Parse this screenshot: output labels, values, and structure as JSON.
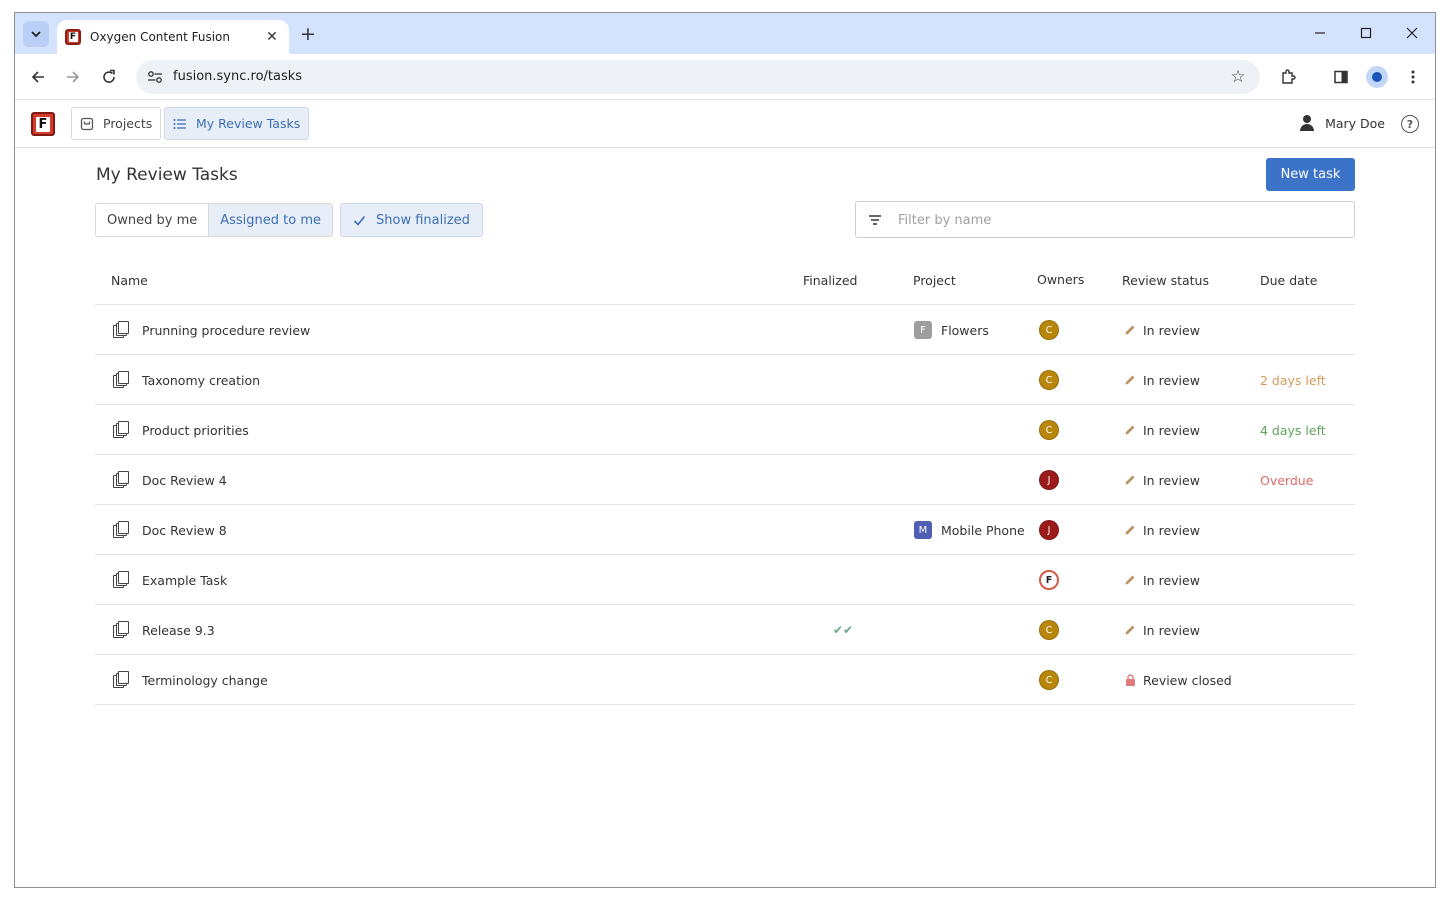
{
  "browser": {
    "tab_title": "Oxygen Content Fusion",
    "url": "fusion.sync.ro/tasks"
  },
  "header": {
    "logo_letter": "F",
    "projects_label": "Projects",
    "my_tasks_label": "My Review Tasks",
    "user_name": "Mary Doe",
    "help_glyph": "?"
  },
  "page": {
    "title": "My Review Tasks",
    "new_task_label": "New task",
    "owned_label": "Owned by me",
    "assigned_label": "Assigned to me",
    "show_finalized_label": "Show finalized",
    "filter_placeholder": "Filter by name"
  },
  "table": {
    "headers": {
      "name": "Name",
      "finalized": "Finalized",
      "project": "Project",
      "owners": "Owners",
      "review_status": "Review status",
      "due_date": "Due date"
    },
    "rows": [
      {
        "name": "Prunning procedure review",
        "finalized": "",
        "project_letter": "F",
        "project": "Flowers",
        "project_color": "#9e9e9e",
        "owner": "C",
        "owner_color": "#b8860b",
        "status": "In review",
        "status_icon": "pencil-icon",
        "due": "",
        "due_color": "#333333"
      },
      {
        "name": "Taxonomy creation",
        "finalized": "",
        "project_letter": "",
        "project": "",
        "project_color": "",
        "owner": "C",
        "owner_color": "#b8860b",
        "status": "In review",
        "status_icon": "pencil-icon",
        "due": "2 days left",
        "due_color": "#d39c5a"
      },
      {
        "name": "Product priorities",
        "finalized": "",
        "project_letter": "",
        "project": "",
        "project_color": "",
        "owner": "C",
        "owner_color": "#b8860b",
        "status": "In review",
        "status_icon": "pencil-icon",
        "due": "4 days left",
        "due_color": "#5fa35f"
      },
      {
        "name": "Doc Review 4",
        "finalized": "",
        "project_letter": "",
        "project": "",
        "project_color": "",
        "owner": "J",
        "owner_color": "#9b1b1b",
        "status": "In review",
        "status_icon": "pencil-icon",
        "due": "Overdue",
        "due_color": "#e06a6a"
      },
      {
        "name": "Doc Review 8",
        "finalized": "",
        "project_letter": "M",
        "project": "Mobile Phone",
        "project_color": "#4f5fb4",
        "owner": "J",
        "owner_color": "#9b1b1b",
        "status": "In review",
        "status_icon": "pencil-icon",
        "due": "",
        "due_color": "#333333"
      },
      {
        "name": "Example Task",
        "finalized": "",
        "project_letter": "",
        "project": "",
        "project_color": "",
        "owner": "F",
        "owner_color": "#ffffff",
        "status": "In review",
        "status_icon": "pencil-icon",
        "due": "",
        "due_color": "#333333"
      },
      {
        "name": "Release 9.3",
        "finalized": "✔✔",
        "project_letter": "",
        "project": "",
        "project_color": "",
        "owner": "C",
        "owner_color": "#b8860b",
        "status": "In review",
        "status_icon": "pencil-icon",
        "due": "",
        "due_color": "#333333"
      },
      {
        "name": "Terminology change",
        "finalized": "",
        "project_letter": "",
        "project": "",
        "project_color": "",
        "owner": "C",
        "owner_color": "#b8860b",
        "status": "Review closed",
        "status_icon": "lock-icon",
        "due": "",
        "due_color": "#333333"
      }
    ]
  },
  "colors": {
    "accent": "#3b73c9",
    "active_bg": "#e8eef7",
    "active_text": "#3b6fb6",
    "pencil": "#b9956a",
    "lock": "#e07c7c"
  }
}
